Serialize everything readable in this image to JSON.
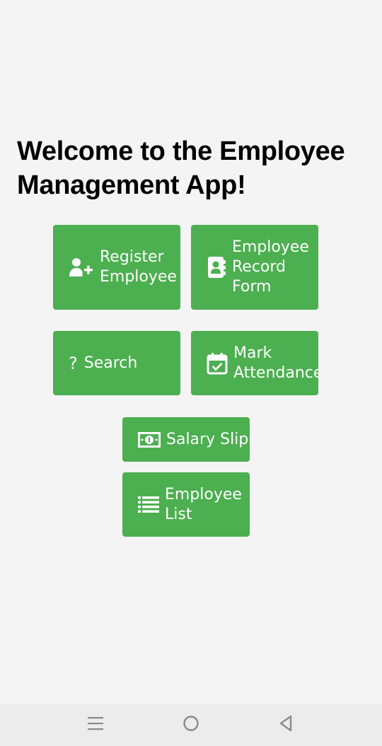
{
  "header": {
    "title": "Welcome to the Employee Management App!"
  },
  "tiles": [
    {
      "label": "Register\nEmployee",
      "icon": "person-add-icon"
    },
    {
      "label": "Employee\nRecord\nForm",
      "icon": "contact-card-icon"
    },
    {
      "label": "Search",
      "icon": "question-mark-icon"
    },
    {
      "label": "Mark\nAttendance",
      "icon": "calendar-check-icon"
    },
    {
      "label": "Salary Slip",
      "icon": "money-bill-icon"
    },
    {
      "label": "Employee\nList",
      "icon": "list-icon"
    }
  ],
  "navbar": {
    "items": [
      {
        "icon": "menu-icon"
      },
      {
        "icon": "home-circle-icon"
      },
      {
        "icon": "back-triangle-icon"
      }
    ]
  },
  "colors": {
    "background": "#f4f4f4",
    "tile": "#4caf50",
    "tile_text": "#ffffff",
    "title_text": "#000000",
    "navbar": "#ececec",
    "nav_icon": "#8a8a8a"
  }
}
